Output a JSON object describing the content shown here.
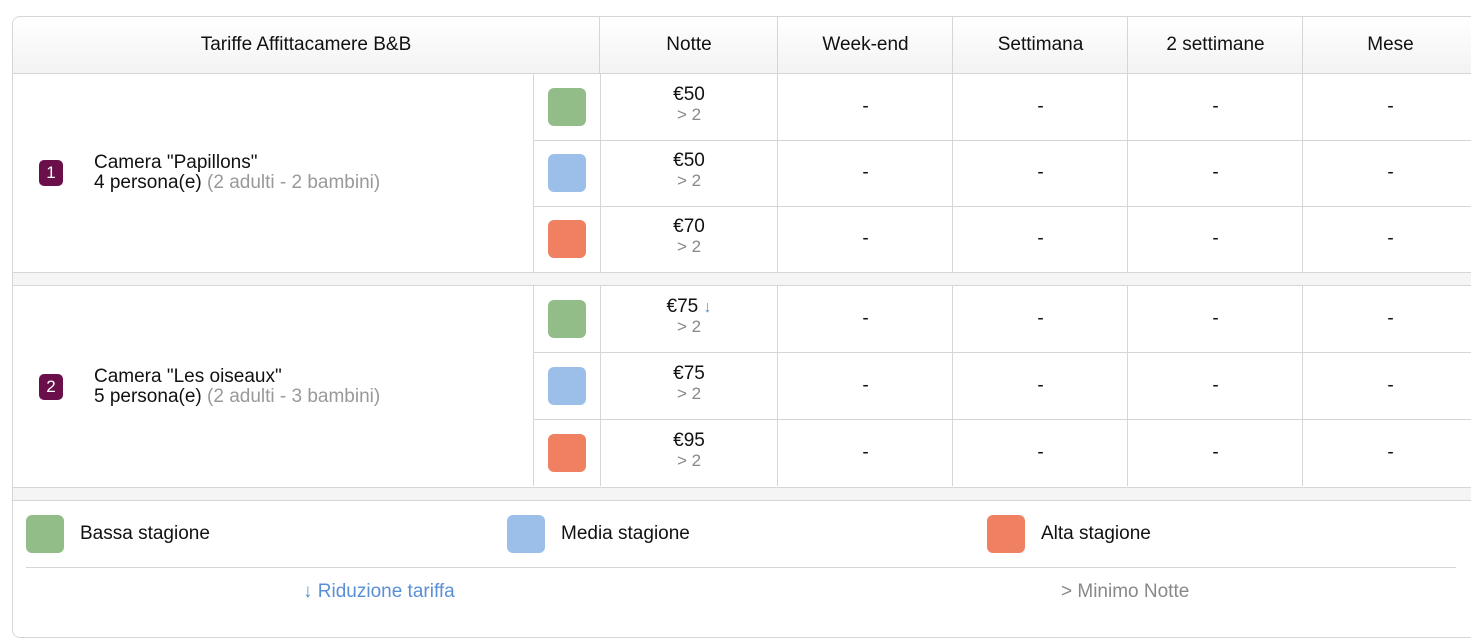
{
  "header": {
    "title": "Tariffe Affittacamere B&B",
    "columns": [
      "Notte",
      "Week-end",
      "Settimana",
      "2 settimane",
      "Mese"
    ]
  },
  "colors": {
    "bassa": "#93bd88",
    "media": "#9cbfea",
    "alta": "#ef8062",
    "room_badge": "#6b0f4a"
  },
  "rooms": [
    {
      "number": "1",
      "name": "Camera \"Papillons\"",
      "capacity": "4 persona(e)",
      "details": "(2 adulti - 2 bambini)",
      "rates": [
        {
          "season": "bassa",
          "price": "€50",
          "reduction": "",
          "min": "> 2",
          "weekend": "-",
          "settimana": "-",
          "due_settimane": "-",
          "mese": "-"
        },
        {
          "season": "media",
          "price": "€50",
          "reduction": "",
          "min": "> 2",
          "weekend": "-",
          "settimana": "-",
          "due_settimane": "-",
          "mese": "-"
        },
        {
          "season": "alta",
          "price": "€70",
          "reduction": "",
          "min": "> 2",
          "weekend": "-",
          "settimana": "-",
          "due_settimane": "-",
          "mese": "-"
        }
      ]
    },
    {
      "number": "2",
      "name": "Camera \"Les oiseaux\"",
      "capacity": "5 persona(e)",
      "details": "(2 adulti - 3 bambini)",
      "rates": [
        {
          "season": "bassa",
          "price": "€75",
          "reduction": "↓",
          "min": "> 2",
          "weekend": "-",
          "settimana": "-",
          "due_settimane": "-",
          "mese": "-"
        },
        {
          "season": "media",
          "price": "€75",
          "reduction": "",
          "min": "> 2",
          "weekend": "-",
          "settimana": "-",
          "due_settimane": "-",
          "mese": "-"
        },
        {
          "season": "alta",
          "price": "€95",
          "reduction": "",
          "min": "> 2",
          "weekend": "-",
          "settimana": "-",
          "due_settimane": "-",
          "mese": "-"
        }
      ]
    }
  ],
  "legend": {
    "bassa": "Bassa stagione",
    "media": "Media stagione",
    "alta": "Alta stagione",
    "reduction_note": "↓ Riduzione tariffa",
    "min_note": "> Minimo Notte"
  }
}
